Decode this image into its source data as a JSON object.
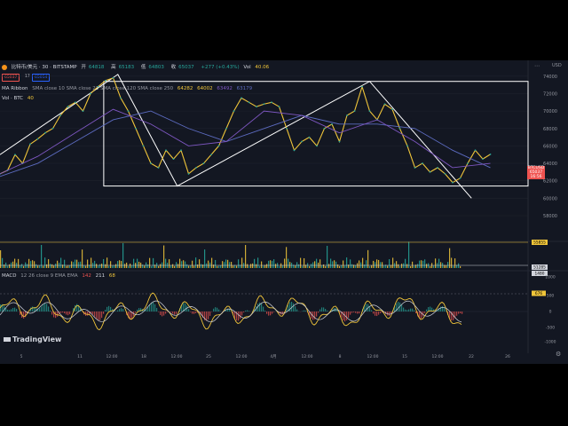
{
  "header": {
    "symbol": "比特币/美元 · 30 · BITSTAMP",
    "ohlc": [
      {
        "label": "开",
        "value": "64818",
        "color": "#26a69a"
      },
      {
        "label": "高",
        "value": "65183",
        "color": "#26a69a"
      },
      {
        "label": "低",
        "value": "64803",
        "color": "#26a69a"
      },
      {
        "label": "收",
        "value": "65037",
        "color": "#26a69a"
      },
      {
        "label": "",
        "value": "+277 (+0.43%)",
        "color": "#26a69a"
      },
      {
        "label": "Vol",
        "value": "40.06",
        "color": "#f0c53a"
      }
    ],
    "sell_price": "65037",
    "spread": "17",
    "buy_price": "65054"
  },
  "indicators": {
    "ma_ribbon": {
      "label": "MA Ribbon",
      "params": "SMA close 10 SMA close 21 SMA close 120 SMA close 250",
      "values": [
        {
          "value": "64282",
          "color": "#f0c53a"
        },
        {
          "value": "64002",
          "color": "#f0c53a"
        },
        {
          "value": "63492",
          "color": "#7e57c2"
        },
        {
          "value": "63179",
          "color": "#5c6bc0"
        }
      ]
    },
    "vol": {
      "label": "Vol · BTC",
      "value": "40"
    },
    "macd": {
      "label": "MACD",
      "params": "12 26 close 9 EMA EMA",
      "values": [
        {
          "value": "142",
          "color": "#ef5350"
        },
        {
          "value": "211",
          "color": "#d1d4dc"
        },
        {
          "value": "68",
          "color": "#f0c53a"
        }
      ]
    }
  },
  "price_axis": {
    "labels": [
      "74000",
      "72000",
      "70000",
      "68000",
      "66000",
      "64000",
      "62000",
      "60000",
      "58000"
    ],
    "current_label": "BTCUSD",
    "current_price": "65037",
    "countdown": "16:56"
  },
  "volume_axis": {
    "labels": [
      "55855",
      "51285",
      "1480"
    ]
  },
  "macd_axis": {
    "labels": [
      "1000",
      "500",
      "676",
      "0",
      "-500",
      "-1000"
    ]
  },
  "time_axis": {
    "labels": [
      "5",
      "11",
      "12:00",
      "18",
      "12:00",
      "25",
      "12:00",
      "4月",
      "12:00",
      "8",
      "12:00",
      "15",
      "12:00",
      "22",
      "26"
    ]
  },
  "branding": {
    "logo_text": "TradingView"
  },
  "chart_data": {
    "type": "line",
    "title": "比特币/美元 · 30 · BITSTAMP",
    "xlabel": "",
    "ylabel": "",
    "ylim": [
      58000,
      75000
    ],
    "y_ticks": [
      58000,
      60000,
      62000,
      64000,
      66000,
      68000,
      70000,
      72000,
      74000
    ],
    "x_tick_labels": [
      "5",
      "11",
      "12:00",
      "18",
      "12:00",
      "25",
      "12:00",
      "4月",
      "12:00",
      "8",
      "12:00",
      "15",
      "12:00",
      "22",
      "26"
    ],
    "series": [
      {
        "color": "#f0c53a",
        "x": [
          0,
          8,
          16,
          24,
          32,
          40,
          48,
          56,
          64,
          72,
          80,
          88,
          96,
          104,
          112,
          120,
          128,
          136,
          144,
          152,
          160,
          168,
          176,
          184,
          192,
          200,
          208,
          216,
          224,
          232,
          240,
          248,
          256,
          264,
          272,
          280,
          288,
          296,
          304,
          312,
          320,
          328,
          336,
          344,
          352,
          360,
          368,
          376,
          384,
          392,
          400,
          408,
          416,
          424,
          432,
          440,
          448,
          456,
          464,
          472,
          480,
          488,
          496,
          504,
          512,
          520
        ],
        "values": [
          62800,
          63200,
          65000,
          64000,
          66200,
          66800,
          67500,
          68000,
          69500,
          70500,
          71000,
          70000,
          72000,
          72800,
          73500,
          73800,
          71500,
          70000,
          68000,
          66000,
          64000,
          63500,
          65500,
          64500,
          65500,
          62800,
          63500,
          64000,
          65000,
          66000,
          68000,
          70000,
          71500,
          71000,
          70500,
          70800,
          71000,
          70500,
          68000,
          65500,
          66500,
          67000,
          66000,
          68000,
          68500,
          66500,
          69500,
          70000,
          72800,
          70000,
          69000,
          70800,
          70200,
          68000,
          66000,
          63500,
          64000,
          63000,
          63500,
          62800,
          61800,
          62300,
          64000,
          65500,
          64500,
          65037
        ]
      },
      {
        "name": "SMA close 250",
        "color": "#5c6bc0",
        "x": [
          0,
          40,
          80,
          120,
          160,
          200,
          240,
          280,
          320,
          360,
          400,
          440,
          480,
          520
        ],
        "values": [
          62500,
          64000,
          66500,
          69000,
          70000,
          68000,
          66500,
          68000,
          69500,
          68500,
          68500,
          68000,
          65500,
          63500
        ]
      },
      {
        "name": "SMA close 120",
        "color": "#7e57c2",
        "x": [
          0,
          40,
          80,
          120,
          160,
          200,
          240,
          280,
          320,
          360,
          400,
          440,
          480,
          520
        ],
        "values": [
          62800,
          64800,
          67500,
          70200,
          68500,
          66000,
          66500,
          70000,
          69500,
          67500,
          69000,
          66500,
          63500,
          64000
        ]
      }
    ],
    "shapes": [
      {
        "type": "rectangle",
        "y_range": [
          61400,
          73400
        ]
      },
      {
        "type": "trendline",
        "points": [
          [
            0,
            65000
          ],
          [
            125,
            74200
          ],
          [
            188,
            61400
          ],
          [
            392,
            73400
          ],
          [
            500,
            60000
          ]
        ]
      }
    ],
    "volume_levels": [
      "55855",
      "51285",
      "1480"
    ]
  }
}
